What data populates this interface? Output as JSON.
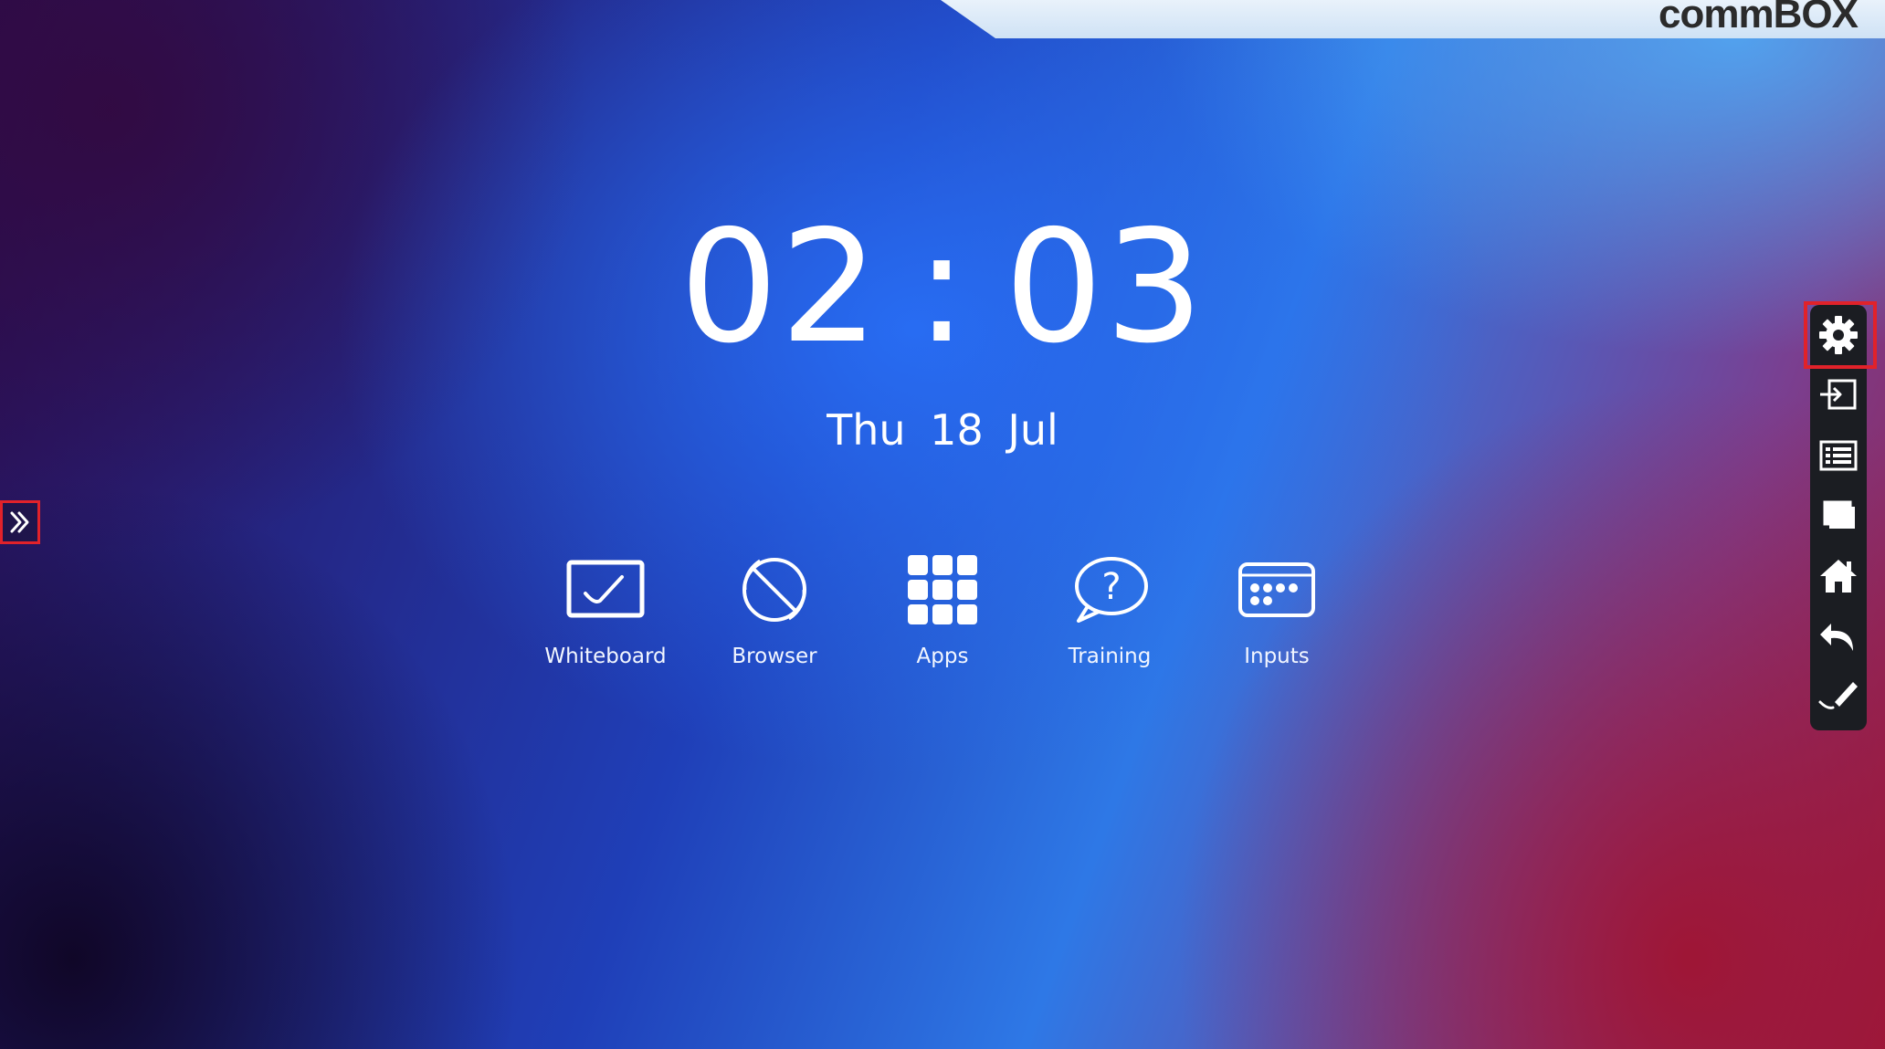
{
  "brand": {
    "logo_text": "commBOX"
  },
  "clock": {
    "hours": "02",
    "separator": ":",
    "minutes": "03"
  },
  "date": {
    "text": "Thu  18  Jul"
  },
  "launcher": {
    "items": [
      {
        "label": "Whiteboard",
        "icon": "whiteboard-icon"
      },
      {
        "label": "Browser",
        "icon": "browser-icon"
      },
      {
        "label": "Apps",
        "icon": "apps-grid-icon"
      },
      {
        "label": "Training",
        "icon": "help-bubble-icon"
      },
      {
        "label": "Inputs",
        "icon": "inputs-icon"
      }
    ]
  },
  "sidebar_left": {
    "icon": "double-chevron-right-icon",
    "highlighted": true
  },
  "toolbar": {
    "items": [
      {
        "icon": "gear-icon",
        "highlighted": true
      },
      {
        "icon": "input-source-icon"
      },
      {
        "icon": "list-icon"
      },
      {
        "icon": "windows-icon"
      },
      {
        "icon": "home-icon"
      },
      {
        "icon": "back-icon"
      },
      {
        "icon": "pen-annotate-icon"
      }
    ]
  },
  "colors": {
    "highlight": "#e1222a",
    "toolbar_bg": "#1b1d22",
    "text": "#ffffff"
  }
}
